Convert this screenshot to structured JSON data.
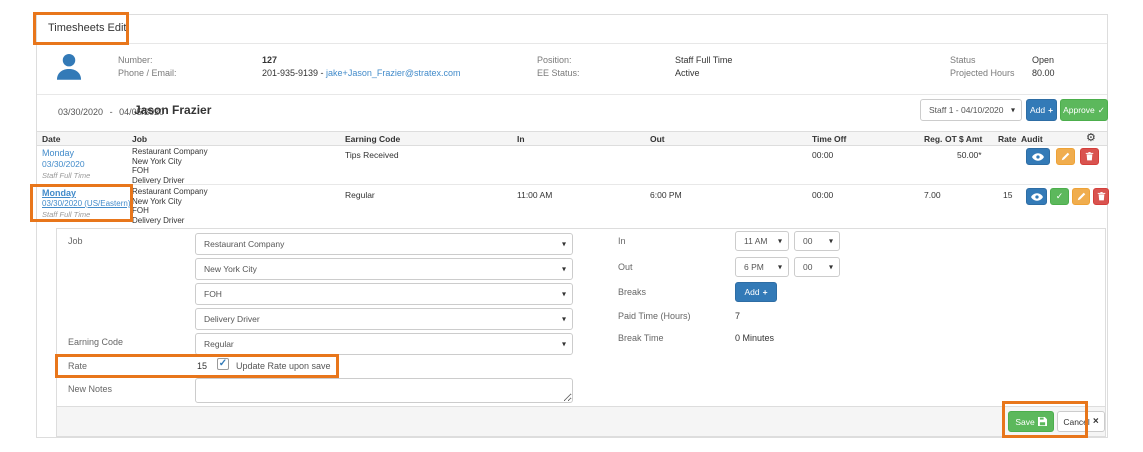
{
  "colors": {
    "annotation_orange": "#e8761b",
    "link_blue": "#428bca",
    "button_blue": "#337ab7",
    "button_green": "#5cb85c",
    "button_yellow": "#f0ad4e",
    "button_red": "#d9534f"
  },
  "page": {
    "title": "Timesheets Edit"
  },
  "profile": {
    "number_label": "Number:",
    "number_value": "127",
    "phone_label": "Phone / Email:",
    "phone_prefix": "201-935-9139 - ",
    "email": "jake+Jason_Frazier@stratex.com",
    "position_label": "Position:",
    "position_value": "Staff Full Time",
    "ee_status_label": "EE Status:",
    "ee_status_value": "Active",
    "status_label": "Status",
    "status_value": "Open",
    "projected_hours_label": "Projected Hours",
    "projected_hours_value": "80.00"
  },
  "period": {
    "start_date": "03/30/2020",
    "separator": "-",
    "end_date": "04/05/2020",
    "employee_name": "Jason Frazier",
    "staff_select_value": "Staff 1 - 04/10/2020",
    "add_button": "Add",
    "approve_button": "Approve"
  },
  "table": {
    "headers": {
      "date": "Date",
      "job": "Job",
      "earning_code": "Earning Code",
      "in": "In",
      "out": "Out",
      "time_off": "Time Off",
      "reg": "Reg.",
      "ot": "OT",
      "amt": "$ Amt",
      "rate": "Rate",
      "audit": "Audit"
    },
    "rows": [
      {
        "day": "Monday",
        "date": "03/30/2020",
        "subtitle": "Staff Full Time",
        "job": [
          "Restaurant Company",
          "New York City",
          "FOH",
          "Delivery Driver"
        ],
        "earning_code": "Tips Received",
        "in": "",
        "out": "",
        "time_off": "00:00",
        "reg": "",
        "amt": "50.00*",
        "rate": ""
      },
      {
        "day": "Monday",
        "date": "03/30/2020 (US/Eastern)",
        "subtitle": "Staff Full Time",
        "job": [
          "Restaurant Company",
          "New York City",
          "FOH",
          "Delivery Driver"
        ],
        "earning_code": "Regular",
        "in": "11:00 AM",
        "out": "6:00 PM",
        "time_off": "00:00",
        "reg": "7.00",
        "amt": "",
        "rate": "15"
      }
    ]
  },
  "form": {
    "job_label": "Job",
    "job_company": "Restaurant Company",
    "job_location": "New York City",
    "job_department": "FOH",
    "job_position": "Delivery Driver",
    "earning_code_label": "Earning Code",
    "earning_code_value": "Regular",
    "rate_label": "Rate",
    "rate_value": "15",
    "update_rate_label": "Update Rate upon save",
    "new_notes_label": "New Notes",
    "in_label": "In",
    "in_hour": "11 AM",
    "in_minute": "00",
    "out_label": "Out",
    "out_hour": "6 PM",
    "out_minute": "00",
    "breaks_label": "Breaks",
    "breaks_add_button": "Add",
    "paid_time_label": "Paid Time (Hours)",
    "paid_time_value": "7",
    "break_time_label": "Break Time",
    "break_time_value": "0 Minutes"
  },
  "footer": {
    "save_button": "Save",
    "cancel_button": "Cancel"
  },
  "icons": {
    "gear": "⚙",
    "caret": "▾",
    "check": "✓",
    "plus": "+",
    "close": "×",
    "checked": "✓"
  }
}
